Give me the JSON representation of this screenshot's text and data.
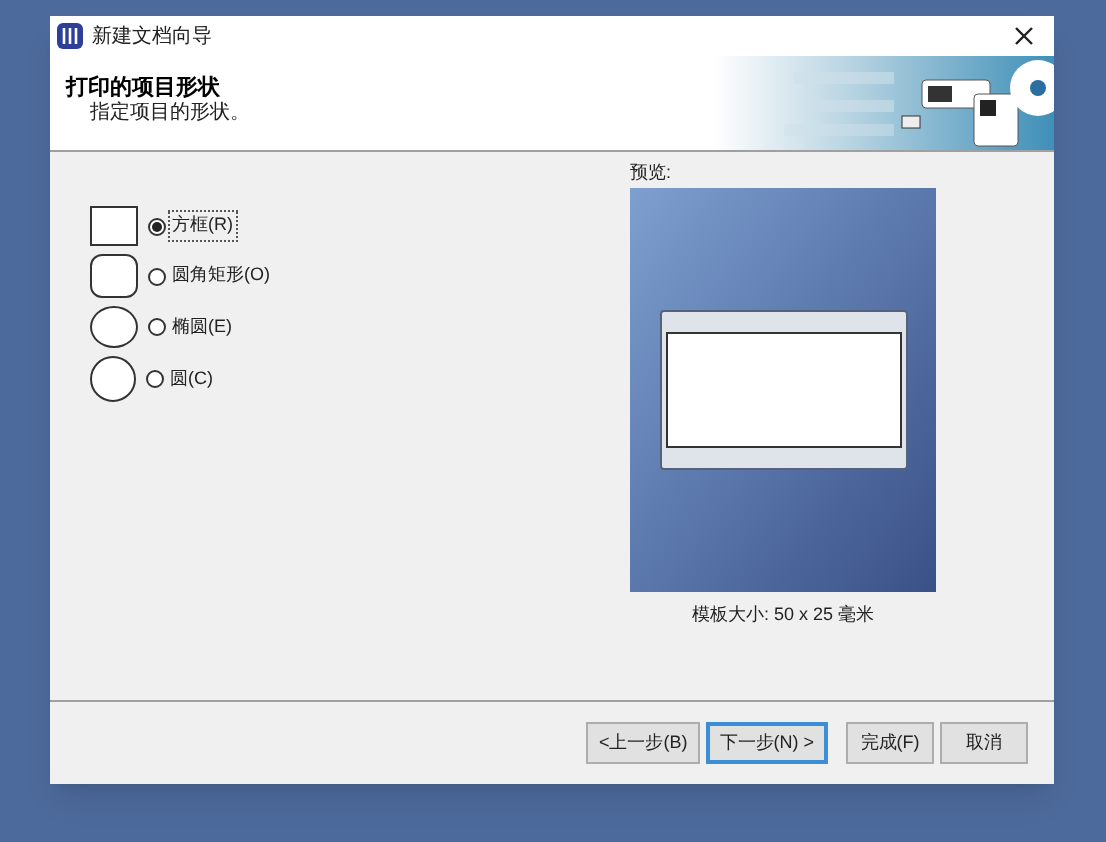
{
  "window": {
    "title": "新建文档向导"
  },
  "header": {
    "title": "打印的项目形状",
    "subtitle": "指定项目的形状。"
  },
  "shapes": [
    {
      "kind": "square",
      "label": "方框(R)",
      "selected": true
    },
    {
      "kind": "rounded",
      "label": "圆角矩形(O)",
      "selected": false
    },
    {
      "kind": "ellipse",
      "label": "椭圆(E)",
      "selected": false
    },
    {
      "kind": "circle",
      "label": "圆(C)",
      "selected": false
    }
  ],
  "preview": {
    "label": "预览:",
    "size_label": "模板大小: 50 x 25 毫米"
  },
  "buttons": [
    {
      "label": "<上一步(B)",
      "focused": false
    },
    {
      "label": "下一步(N) >",
      "focused": true
    },
    {
      "label": "完成(F)",
      "focused": false
    },
    {
      "label": "取消",
      "focused": false
    }
  ]
}
